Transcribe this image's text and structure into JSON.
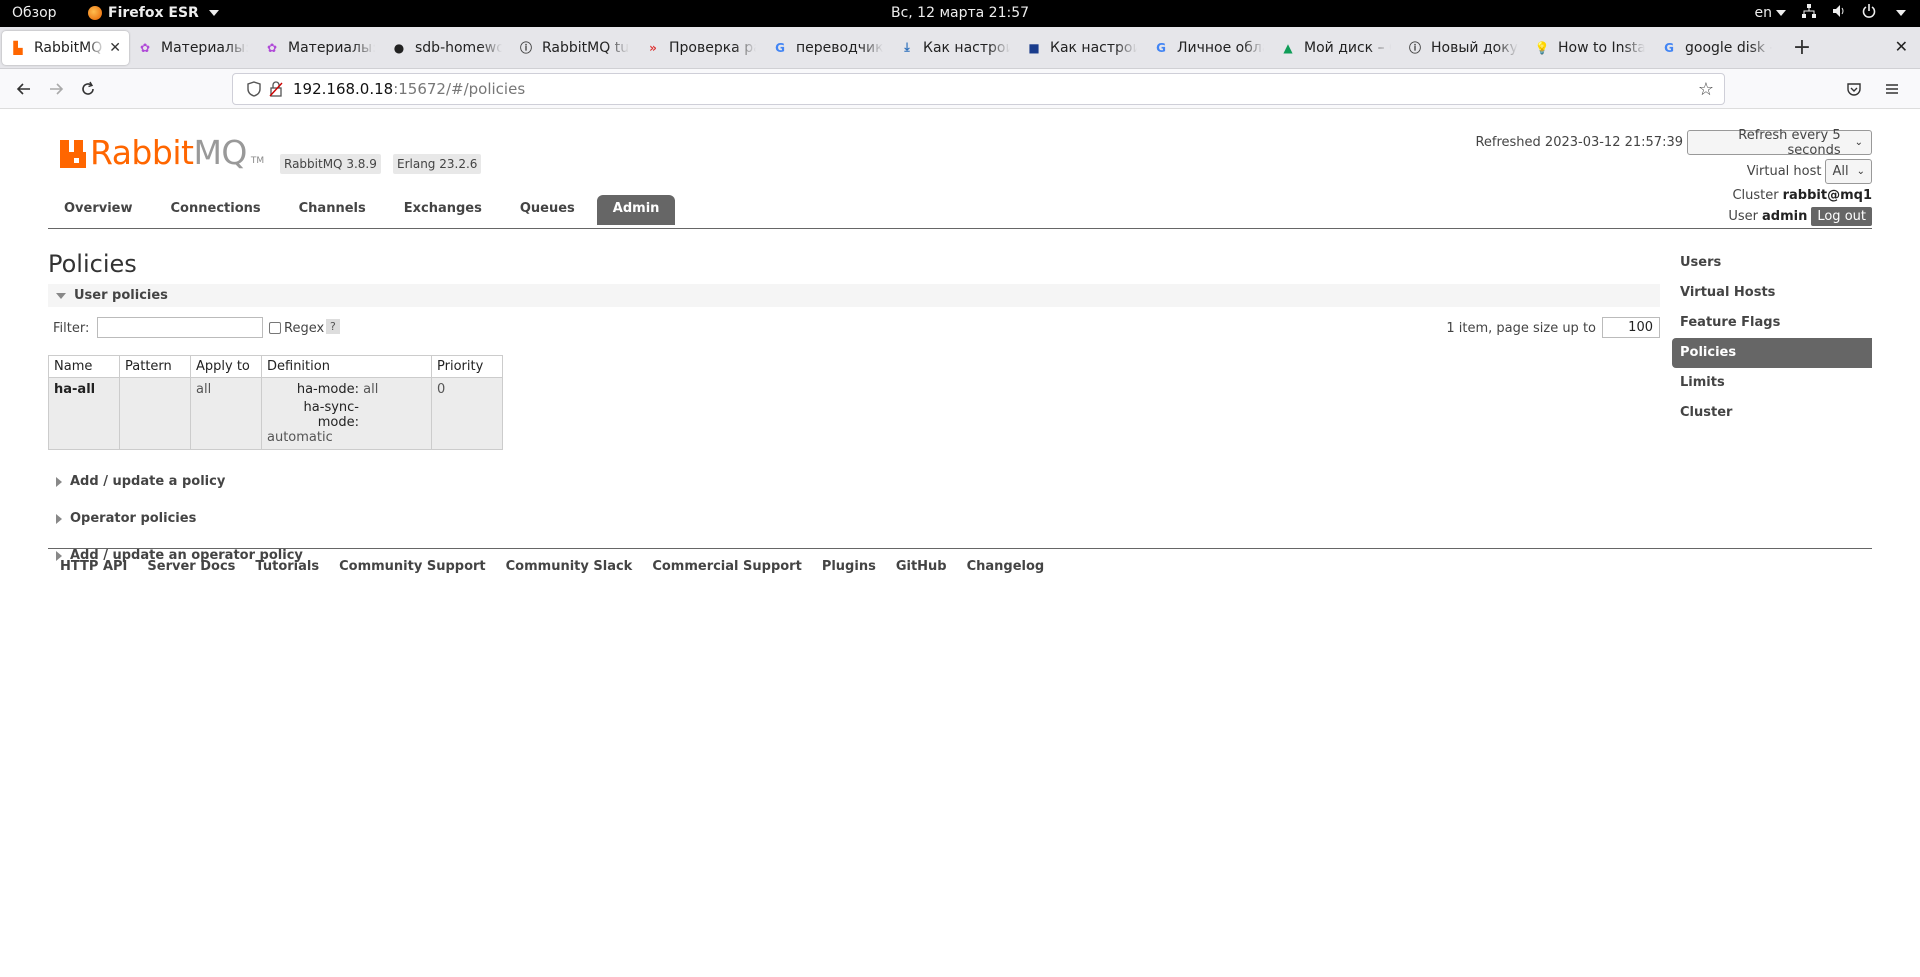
{
  "os_bar": {
    "activities": "Обзор",
    "app_name": "Firefox ESR",
    "clock": "Вс, 12 марта  21:57",
    "lang": "en"
  },
  "tabs": [
    {
      "label": "RabbitMQ",
      "icon": "rabbitmq-icon",
      "active": true
    },
    {
      "label": "Материалы:",
      "icon": "materials-icon"
    },
    {
      "label": "Материалы:",
      "icon": "materials-icon"
    },
    {
      "label": "sdb-homewo",
      "icon": "github-icon"
    },
    {
      "label": "RabbitMQ tu",
      "icon": "info-icon"
    },
    {
      "label": "Проверка ра",
      "icon": "double-chevron-icon"
    },
    {
      "label": "переводчик",
      "icon": "google-icon"
    },
    {
      "label": "Как настрои",
      "icon": "download-icon"
    },
    {
      "label": "Как настрои",
      "icon": "bookmark-icon"
    },
    {
      "label": "Личное обла",
      "icon": "google-icon"
    },
    {
      "label": "Мой диск – G",
      "icon": "drive-icon"
    },
    {
      "label": "Новый доку",
      "icon": "info-icon"
    },
    {
      "label": "How to Insta",
      "icon": "lightbulb-icon"
    },
    {
      "label": "google disk -",
      "icon": "google-icon"
    }
  ],
  "url": {
    "host": "192.168.0.18",
    "path": ":15672/#/policies"
  },
  "header": {
    "version_rabbit": "RabbitMQ 3.8.9",
    "version_erlang": "Erlang 23.2.6",
    "refreshed_label": "Refreshed 2023-03-12 21:57:39",
    "refresh_option": "Refresh every 5 seconds",
    "vhost_label": "Virtual host",
    "vhost_value": "All",
    "cluster_label": "Cluster",
    "cluster_value": "rabbit@mq1",
    "user_label": "User",
    "user_value": "admin",
    "logout": "Log out"
  },
  "logo": {
    "rabbit": "Rabbit",
    "mq": "MQ",
    "tm": "TM"
  },
  "main_tabs": [
    "Overview",
    "Connections",
    "Channels",
    "Exchanges",
    "Queues",
    "Admin"
  ],
  "content": {
    "title": "Policies",
    "user_policies": "User policies",
    "filter_label": "Filter:",
    "regex_label": "Regex",
    "regex_help": "?",
    "paging": "1 item, page size up to",
    "page_size": "100",
    "table_headers": [
      "Name",
      "Pattern",
      "Apply to",
      "Definition",
      "Priority"
    ],
    "row": {
      "name": "ha-all",
      "pattern": "",
      "apply_to": "all",
      "def_k1": "ha-mode:",
      "def_v1": "all",
      "def_k2": "ha-sync-mode:",
      "def_v2": "automatic",
      "priority": "0"
    },
    "add_policy": "Add / update a policy",
    "operator_policies": "Operator policies",
    "add_operator_policy": "Add / update an operator policy"
  },
  "right_nav": [
    "Users",
    "Virtual Hosts",
    "Feature Flags",
    "Policies",
    "Limits",
    "Cluster"
  ],
  "footer": [
    "HTTP API",
    "Server Docs",
    "Tutorials",
    "Community Support",
    "Community Slack",
    "Commercial Support",
    "Plugins",
    "GitHub",
    "Changelog"
  ],
  "colors": {
    "brand": "#ff6600",
    "nav_active": "#666666"
  }
}
